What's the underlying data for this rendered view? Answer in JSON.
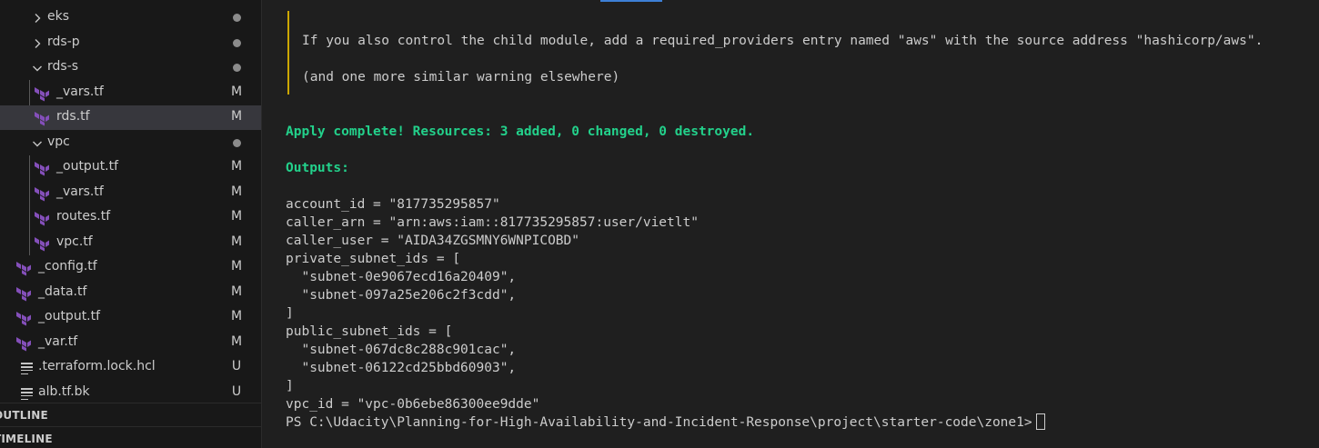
{
  "sidebar": {
    "rows": [
      {
        "label": "eks",
        "kind": "folder-collapsed",
        "badge": "dot"
      },
      {
        "label": "rds-p",
        "kind": "folder-collapsed",
        "badge": "dot"
      },
      {
        "label": "rds-s",
        "kind": "folder-expanded",
        "badge": "dot"
      },
      {
        "label": "_vars.tf",
        "kind": "terraform-file",
        "badge": "M"
      },
      {
        "label": "rds.tf",
        "kind": "terraform-file",
        "badge": "M",
        "selected": true
      },
      {
        "label": "vpc",
        "kind": "folder-expanded",
        "badge": "dot"
      },
      {
        "label": "_output.tf",
        "kind": "terraform-file",
        "badge": "M"
      },
      {
        "label": "_vars.tf",
        "kind": "terraform-file",
        "badge": "M"
      },
      {
        "label": "routes.tf",
        "kind": "terraform-file",
        "badge": "M"
      },
      {
        "label": "vpc.tf",
        "kind": "terraform-file",
        "badge": "M"
      },
      {
        "label": "_config.tf",
        "kind": "terraform-file",
        "badge": "M"
      },
      {
        "label": "_data.tf",
        "kind": "terraform-file",
        "badge": "M"
      },
      {
        "label": "_output.tf",
        "kind": "terraform-file",
        "badge": "M"
      },
      {
        "label": "_var.tf",
        "kind": "terraform-file",
        "badge": "M"
      },
      {
        "label": ".terraform.lock.hcl",
        "kind": "lines-file",
        "badge": "U"
      },
      {
        "label": "alb.tf.bk",
        "kind": "lines-file",
        "badge": "U"
      }
    ],
    "outline_label": "OUTLINE",
    "timeline_label": "TIMELINE",
    "terraform_icon_color": "#844fba"
  },
  "terminal": {
    "warning_lines": [
      "If you also control the child module, add a required_providers entry named \"aws\" with the source address \"hashicorp/aws\".",
      "(and one more similar warning elsewhere)"
    ],
    "apply_complete": "Apply complete! Resources: 3 added, 0 changed, 0 destroyed.",
    "outputs_header": "Outputs:",
    "output_lines": [
      "account_id = \"817735295857\"",
      "caller_arn = \"arn:aws:iam::817735295857:user/vietlt\"",
      "caller_user = \"AIDA34ZGSMNY6WNPICOBD\"",
      "private_subnet_ids = [",
      "  \"subnet-0e9067ecd16a20409\",",
      "  \"subnet-097a25e206c2f3cdd\",",
      "]",
      "public_subnet_ids = [",
      "  \"subnet-067dc8c288c901cac\",",
      "  \"subnet-06122cd25bbd60903\",",
      "]",
      "vpc_id = \"vpc-0b6ebe86300ee9dde\""
    ],
    "prompt": "PS C:\\Udacity\\Planning-for-High-Availability-and-Incident-Response\\project\\starter-code\\zone1>",
    "colors": {
      "success_green": "#23d18b",
      "warning_bar": "#cca700"
    }
  }
}
